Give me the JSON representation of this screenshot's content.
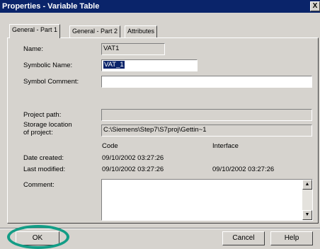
{
  "window": {
    "title": "Properties - Variable Table",
    "close_glyph": "X"
  },
  "tabs": [
    {
      "label": "General - Part 1",
      "active": true
    },
    {
      "label": "General - Part 2",
      "active": false
    },
    {
      "label": "Attributes",
      "active": false
    }
  ],
  "form": {
    "name_label": "Name:",
    "name_value": "VAT1",
    "symbolic_name_label": "Symbolic Name:",
    "symbolic_name_value": "VAT_1",
    "symbol_comment_label": "Symbol Comment:",
    "symbol_comment_value": "",
    "project_path_label": "Project path:",
    "project_path_value": "",
    "storage_label_line1": "Storage location",
    "storage_label_line2": "of project:",
    "storage_value": "C:\\Siemens\\Step7\\S7proj\\Gettin~1",
    "code_header": "Code",
    "interface_header": "Interface",
    "date_created_label": "Date created:",
    "date_created_code": "09/10/2002  03:27:26",
    "last_modified_label": "Last modified:",
    "last_modified_code": "09/10/2002  03:27:26",
    "last_modified_interface": "09/10/2002  03:27:26",
    "comment_label": "Comment:",
    "comment_value": ""
  },
  "buttons": {
    "ok": "OK",
    "cancel": "Cancel",
    "help": "Help"
  },
  "colors": {
    "dialog_face": "#d6d3ce",
    "title_bar": "#0a246a",
    "highlight_ring": "#139d86"
  }
}
